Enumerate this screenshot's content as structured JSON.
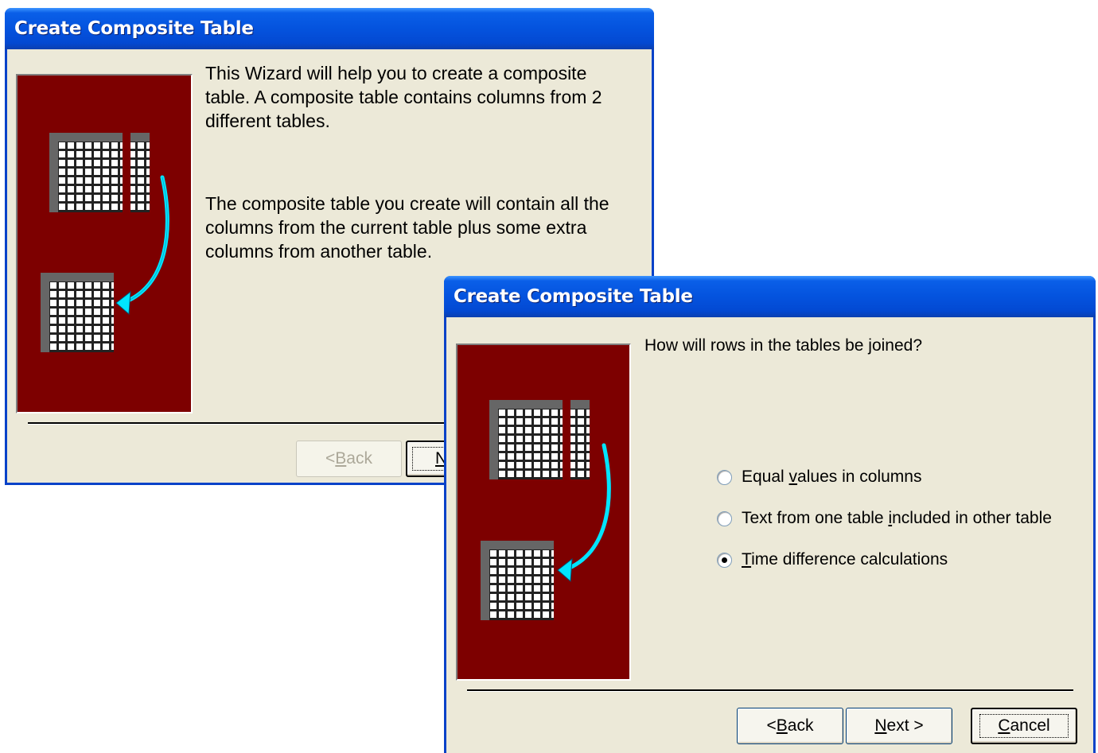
{
  "back_dialog": {
    "title": "Create Composite Table",
    "paragraph1": "This Wizard will help you to create a composite table.  A composite table contains columns from 2 different tables.",
    "paragraph2": "The composite table you create will contain all the columns from the current table plus some extra columns from another table.",
    "back_label_pre": "< ",
    "back_label_mnemonic": "B",
    "back_label_post": "ack",
    "next_label_visible": "N"
  },
  "front_dialog": {
    "title": "Create Composite Table",
    "question": "How will rows in the tables be joined?",
    "options": [
      {
        "pre": "Equal ",
        "mnemonic": "v",
        "post": "alues in columns",
        "checked": false
      },
      {
        "pre": "Text from one table ",
        "mnemonic": "i",
        "post": "ncluded in other table",
        "checked": false
      },
      {
        "pre": "",
        "mnemonic": "T",
        "post": "ime difference calculations",
        "checked": true
      }
    ],
    "back_label_pre": "< ",
    "back_label_mnemonic": "B",
    "back_label_post": "ack",
    "next_label_pre": "",
    "next_label_mnemonic": "N",
    "next_label_post": "ext >",
    "cancel_label_pre": "",
    "cancel_label_mnemonic": "C",
    "cancel_label_post": "ancel"
  },
  "illustration": {
    "background": "#7d0000",
    "arrow_color": "#00e5ff",
    "icon": "table-join-illustration"
  }
}
